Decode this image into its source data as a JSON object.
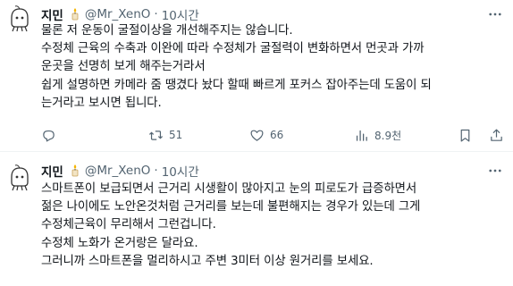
{
  "tweets": [
    {
      "author_name": "지민",
      "handle": "@Mr_XenO",
      "separator": "·",
      "time": "10시간",
      "lines": [
        "물론 저 운동이 굴절이상을 개선해주지는 않습니다.",
        "수정체 근육의 수축과 이완에 따라 수정체가 굴절력이 변화하면서 먼곳과 가까",
        "운곳을 선명히 보게 해주는거라서",
        "쉽게 설명하면 카메라 줌 땡겼다 놨다 할때 빠르게 포커스 잡아주는데 도움이 되",
        "는거라고 보시면 됩니다."
      ],
      "actions": {
        "retweets": "51",
        "likes": "66",
        "views": "8.9천"
      }
    },
    {
      "author_name": "지민",
      "handle": "@Mr_XenO",
      "separator": "·",
      "time": "10시간",
      "lines": [
        "스마트폰이 보급되면서 근거리 시생활이 많아지고 눈의 피로도가 급증하면서",
        "젊은 나이에도 노안온것처럼 근거리를 보는데 불편해지는 경우가 있는데 그게",
        "수정체근육이 무리해서 그런겁니다.",
        "수정체 노화가 온거랑은 달라요.",
        "그러니까 스마트폰을 멀리하시고 주변 3미터 이상 원거리를 보세요."
      ]
    }
  ],
  "icons": {
    "more": "more-horizontal-icon",
    "reply": "reply-icon",
    "retweet": "retweet-icon",
    "like": "heart-icon",
    "views": "views-bar-chart-icon",
    "bookmark": "bookmark-icon",
    "share": "share-icon",
    "badge": "candle-badge-icon"
  },
  "colors": {
    "text": "#0f1419",
    "secondary": "#536471",
    "divider": "#eff3f4"
  }
}
